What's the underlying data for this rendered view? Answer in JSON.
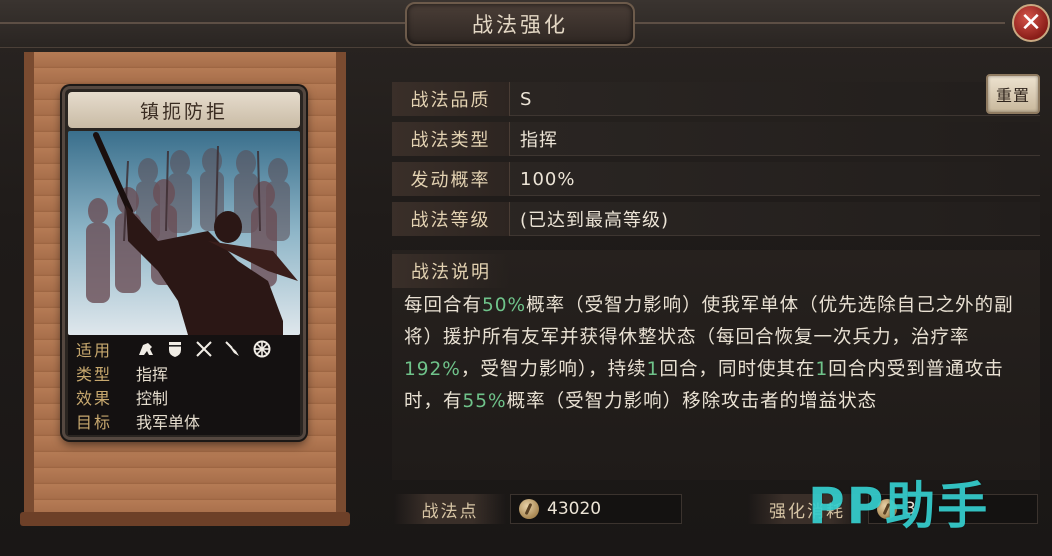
{
  "window": {
    "title": "战法强化",
    "close_glyph": "✕"
  },
  "card": {
    "name": "镇扼防拒",
    "info": [
      {
        "key": "适用",
        "value": ""
      },
      {
        "key": "类型",
        "value": "指挥"
      },
      {
        "key": "效果",
        "value": "控制"
      },
      {
        "key": "目标",
        "value": "我军单体"
      }
    ],
    "unit_icons": [
      "cavalry-icon",
      "shield-icon",
      "crossed-spears-icon",
      "archer-icon",
      "wheel-icon"
    ]
  },
  "fields": [
    {
      "label": "战法品质",
      "value": "S"
    },
    {
      "label": "战法类型",
      "value": "指挥"
    },
    {
      "label": "发动概率",
      "value": "100%"
    },
    {
      "label": "战法等级",
      "value": "(已达到最高等级)"
    }
  ],
  "reset_label": "重置",
  "description": {
    "label": "战法说明",
    "p1": "每回合有",
    "h1": "50%",
    "p2": "概率（受智力影响）使我军单体（优先选除自己之外的副将）援护所有友军并获得休整状态（每回合恢复一次兵力，治疗率",
    "h2": "192%",
    "p3": "，受智力影响），持续",
    "h3": "1",
    "p4": "回合，同时使其在",
    "h4": "1",
    "p5": "回合内受到普通攻击时，有",
    "h5": "55%",
    "p6": "概率（受智力影响）移除攻击者的增益状态"
  },
  "bottom": {
    "points_label": "战法点",
    "points_value": "43020",
    "cost_label": "强化消耗",
    "cost_value": "3"
  },
  "watermark": "PP助手",
  "colors": {
    "highlight": "#6fc38a",
    "label_gold": "#c7a86e",
    "close_red": "#b23a30"
  }
}
